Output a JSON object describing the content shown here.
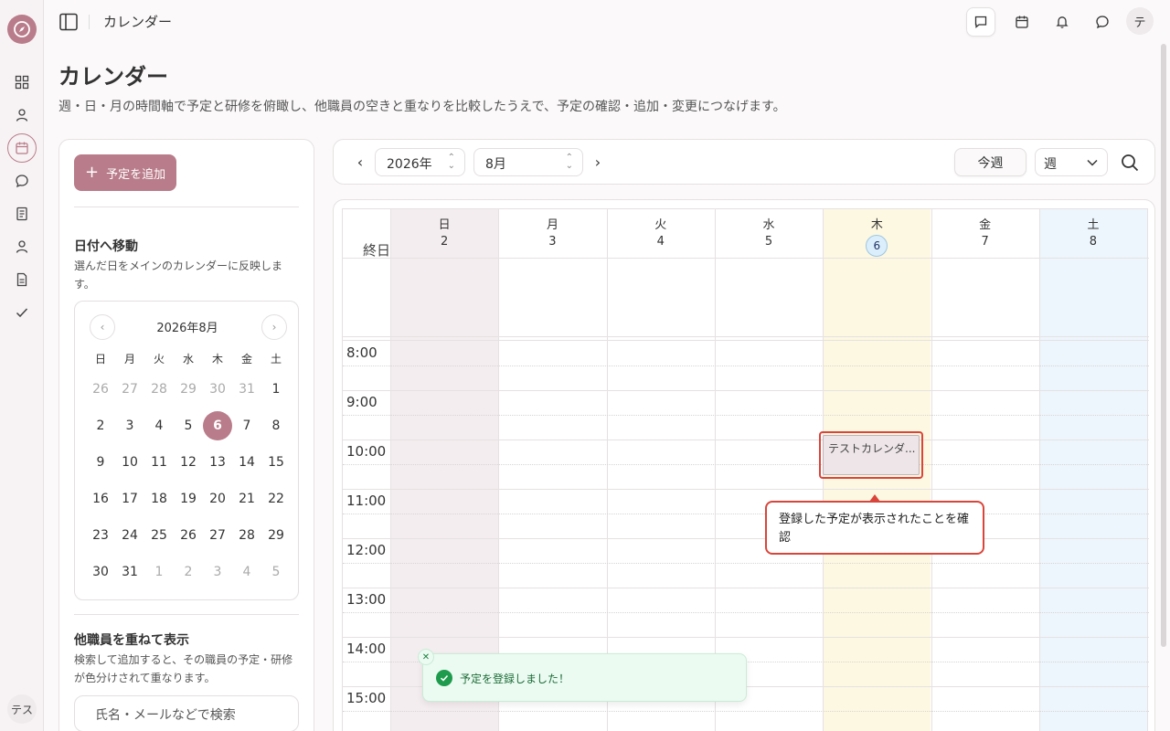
{
  "header": {
    "title": "カレンダー",
    "avatar_initial": "テ"
  },
  "rail": {
    "user_initial": "テス"
  },
  "page": {
    "title": "カレンダー",
    "description": "週・日・月の時間軸で予定と研修を俯瞰し、他職員の空きと重なりを比較したうえで、予定の確認・追加・変更につなげます。"
  },
  "sidebar": {
    "add_button": "予定を追加",
    "goto_title": "日付へ移動",
    "goto_desc": "選んだ日をメインのカレンダーに反映します。",
    "overlay_title": "他職員を重ねて表示",
    "overlay_desc": "検索して追加すると、その職員の予定・研修が色分けされて重なります。",
    "search_placeholder": "氏名・メールなどで検索"
  },
  "mini_calendar": {
    "title": "2026年8月",
    "weekdays": [
      "日",
      "月",
      "火",
      "水",
      "木",
      "金",
      "土"
    ],
    "days": [
      "26",
      "27",
      "28",
      "29",
      "30",
      "31",
      "1",
      "2",
      "3",
      "4",
      "5",
      "6",
      "7",
      "8",
      "9",
      "10",
      "11",
      "12",
      "13",
      "14",
      "15",
      "16",
      "17",
      "18",
      "19",
      "20",
      "21",
      "22",
      "23",
      "24",
      "25",
      "26",
      "27",
      "28",
      "29",
      "30",
      "31",
      "1",
      "2",
      "3",
      "4",
      "5"
    ],
    "selected": "6"
  },
  "toolbar": {
    "year": "2026年",
    "month": "8月",
    "today_button": "今週",
    "view": "週"
  },
  "week": {
    "days": [
      {
        "name": "日",
        "date": "2"
      },
      {
        "name": "月",
        "date": "3"
      },
      {
        "name": "火",
        "date": "4"
      },
      {
        "name": "水",
        "date": "5"
      },
      {
        "name": "木",
        "date": "6"
      },
      {
        "name": "金",
        "date": "7"
      },
      {
        "name": "土",
        "date": "8"
      }
    ],
    "allday_label": "終日",
    "hours": [
      "8:00",
      "9:00",
      "10:00",
      "11:00",
      "12:00",
      "13:00",
      "14:00",
      "15:00"
    ]
  },
  "event": {
    "title": "テストカレンダ..."
  },
  "callout": {
    "text": "登録した予定が表示されたことを確認"
  },
  "toast": {
    "message": "予定を登録しました！"
  },
  "colors": {
    "accent": "#b97c8a",
    "sunday_bg": "#f4edef",
    "today_bg": "#fdf8e1",
    "saturday_bg": "#edf6fd",
    "highlight_red": "#d9453a",
    "success_green": "#1e9b4c"
  }
}
